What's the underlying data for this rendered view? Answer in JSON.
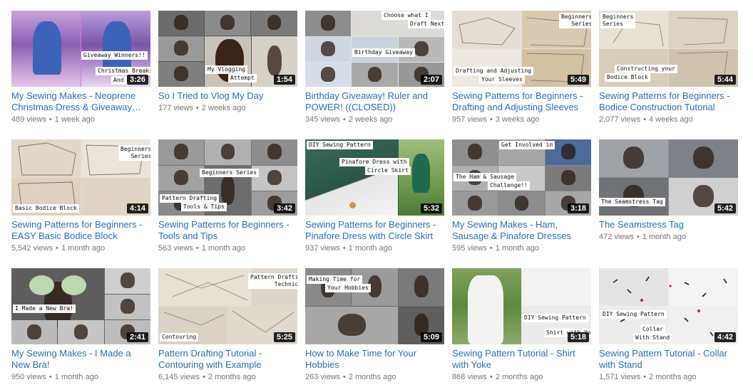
{
  "videos": [
    {
      "title": "My Sewing Makes - Neoprene Christmas Dress & Giveaway Winners!!",
      "views": "489 views",
      "age": "1 week ago",
      "duration": "3:26",
      "captions": [
        "Giveaway Winners!!",
        "Christmas Breaks",
        "And D"
      ]
    },
    {
      "title": "So I Tried to Vlog My Day",
      "views": "177 views",
      "age": "2 weeks ago",
      "duration": "1:54",
      "captions": [
        "My Vlogging",
        "Attempt"
      ]
    },
    {
      "title": "Birthday Giveaway! Ruler and POWER! ((CLOSED))",
      "views": "345 views",
      "age": "2 weeks ago",
      "duration": "2:07",
      "captions": [
        "Choose what I",
        "Draft Next",
        "Birthday Giveaway"
      ]
    },
    {
      "title": "Sewing Patterns for Beginners - Drafting and Adjusting Sleeves",
      "views": "957 views",
      "age": "3 weeks ago",
      "duration": "5:49",
      "captions": [
        "Beginners",
        "Series",
        "Drafting and Adjusting",
        "Your Sleeves"
      ]
    },
    {
      "title": "Sewing Patterns for Beginners - Bodice Construction Tutorial",
      "views": "2,077 views",
      "age": "4 weeks ago",
      "duration": "5:44",
      "captions": [
        "Beginners",
        "Series",
        "Constructing your",
        "Bodice Block"
      ]
    },
    {
      "title": "Sewing Patterns for Beginners - EASY Basic Bodice Block",
      "views": "5,542 views",
      "age": "1 month ago",
      "duration": "4:14",
      "captions": [
        "Beginners",
        "Series",
        "Basic Bodice Block"
      ]
    },
    {
      "title": "Sewing Patterns for Beginners - Tools and Tips",
      "views": "563 views",
      "age": "1 month ago",
      "duration": "3:42",
      "captions": [
        "Beginners Series",
        "Pattern Drafting",
        "Tools & Tips"
      ]
    },
    {
      "title": "Sewing Patterns for Beginners - Pinafore Dress with Circle Skirt",
      "views": "937 views",
      "age": "1 month ago",
      "duration": "5:32",
      "captions": [
        "DIY Sewing Pattern",
        "Pinafore Dress with",
        "Circle Skirt"
      ]
    },
    {
      "title": "My Sewing Makes - Ham, Sausage & Pinafore Dresses",
      "views": "595 views",
      "age": "1 month ago",
      "duration": "3:18",
      "captions": [
        "Get Involved in",
        "The Ham & Sausage",
        "Challenge!!"
      ]
    },
    {
      "title": "The Seamstress Tag",
      "views": "472 views",
      "age": "1 month ago",
      "duration": "5:42",
      "captions": [
        "The Seamstress Tag"
      ]
    },
    {
      "title": "My Sewing Makes - I Made a New Bra!",
      "views": "950 views",
      "age": "1 month ago",
      "duration": "2:41",
      "captions": [
        "I Made a New Bra!"
      ]
    },
    {
      "title": "Pattern Drafting Tutorial - Contouring with Example",
      "views": "6,145 views",
      "age": "2 months ago",
      "duration": "5:25",
      "captions": [
        "Pattern Drafting",
        "Technique",
        "Contouring"
      ]
    },
    {
      "title": "How to Make Time for Your Hobbies",
      "views": "263 views",
      "age": "2 months ago",
      "duration": "5:09",
      "captions": [
        "Making Time for",
        "Your Hobbies"
      ]
    },
    {
      "title": "Sewing Pattern Tutorial - Shirt with Yoke",
      "views": "868 views",
      "age": "2 months ago",
      "duration": "5:18",
      "captions": [
        "DIY Sewing Pattern",
        "Shirt with Yoke"
      ]
    },
    {
      "title": "Sewing Pattern Tutorial - Collar with Stand",
      "views": "1,571 views",
      "age": "2 months ago",
      "duration": "4:42",
      "captions": [
        "DIY Sewing Pattern",
        "Collar",
        "With Stand"
      ]
    }
  ],
  "separator": "•",
  "colors": {
    "title": "#2a6ebb",
    "meta": "#767676",
    "duration_bg": "#000000"
  }
}
